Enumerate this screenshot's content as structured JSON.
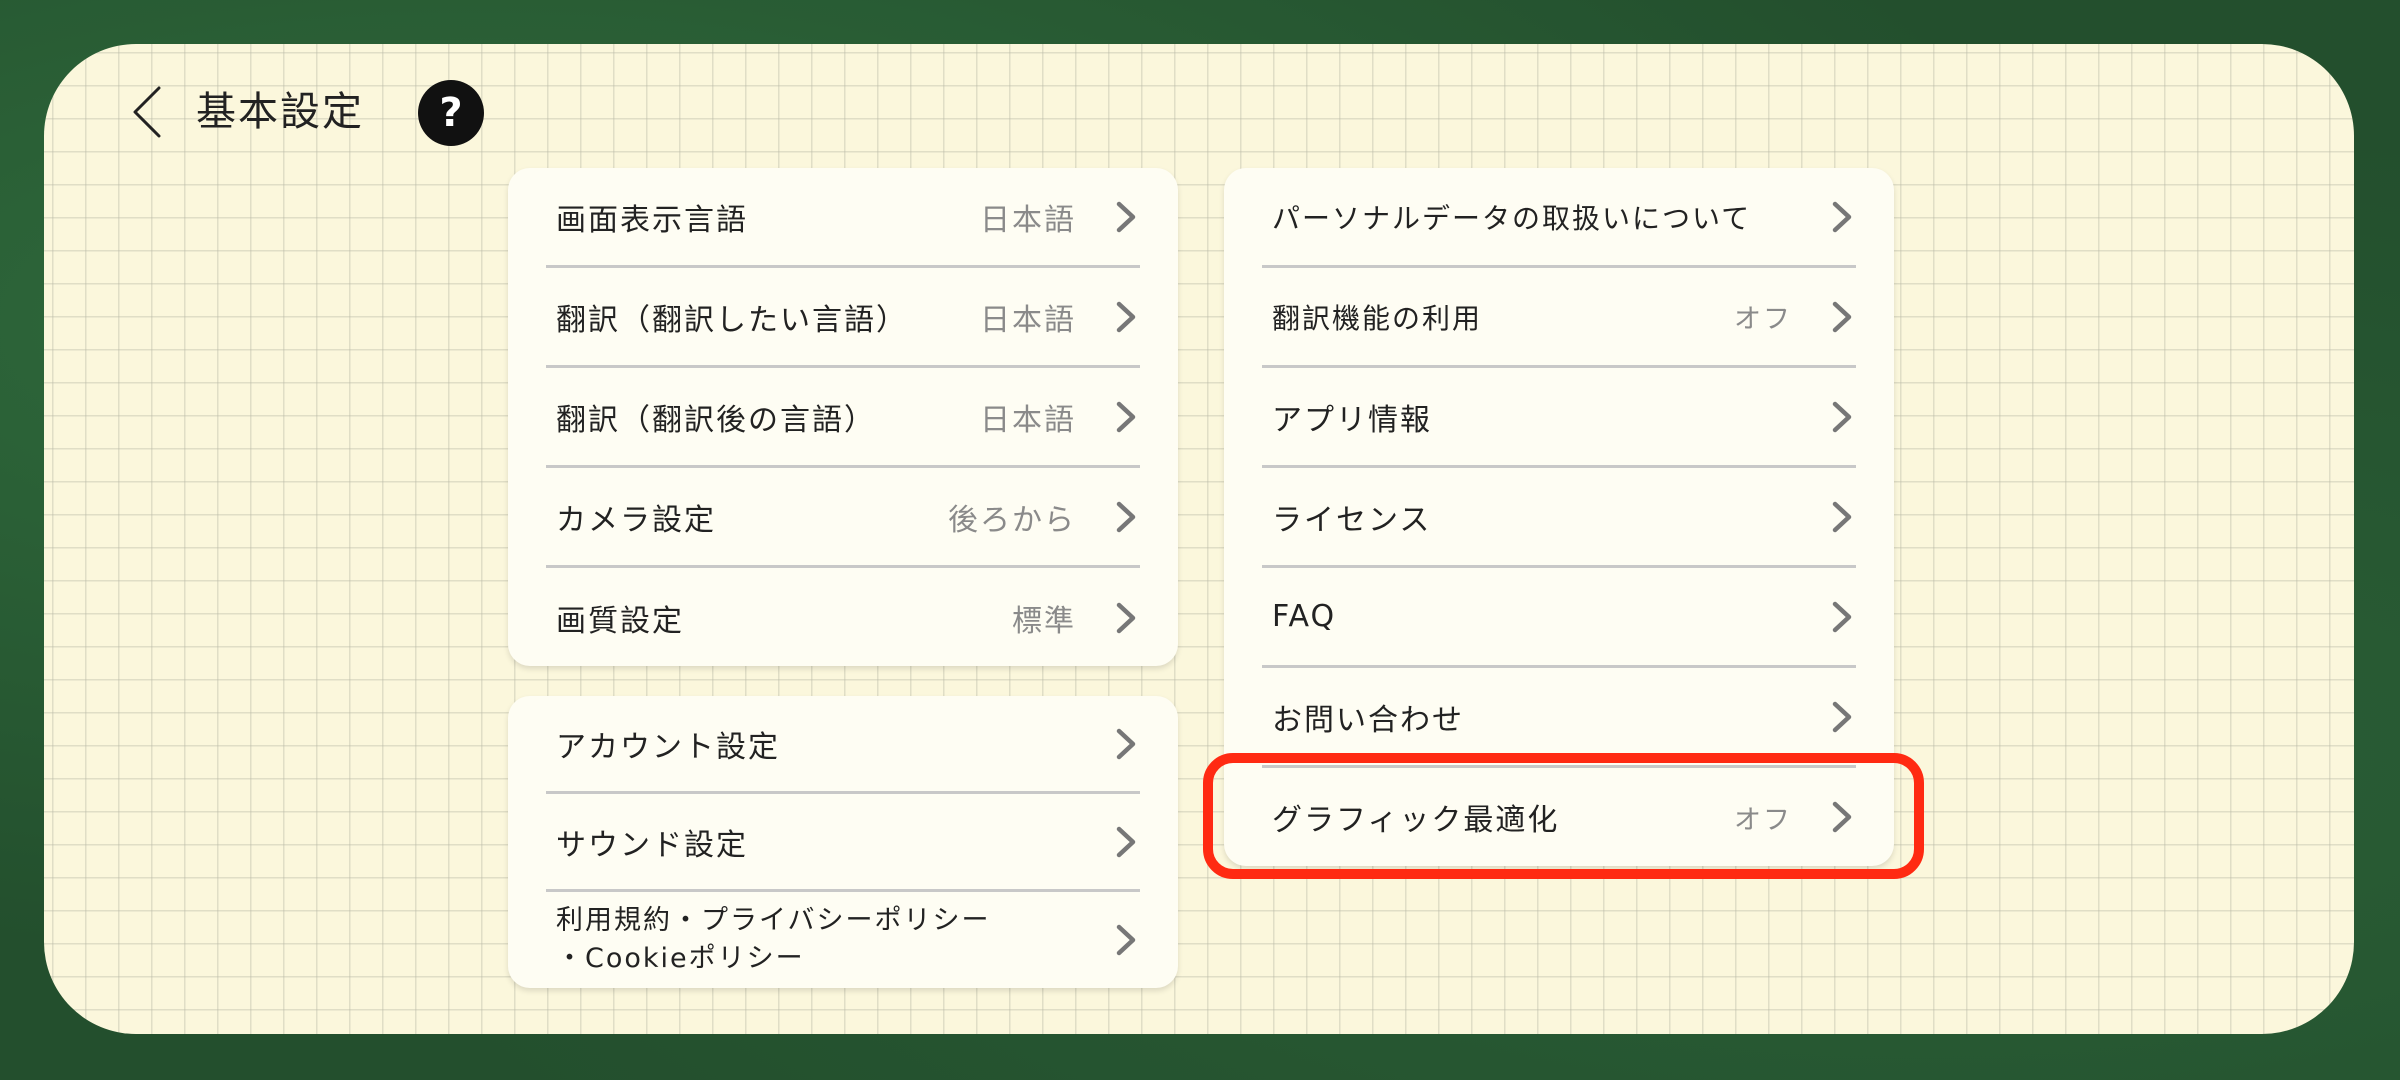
{
  "header": {
    "title": "基本設定",
    "help_label": "?"
  },
  "left_top_card": {
    "items": [
      {
        "label": "画面表示言語",
        "value": "日本語"
      },
      {
        "label": "翻訳（翻訳したい言語）",
        "value": "日本語"
      },
      {
        "label": "翻訳（翻訳後の言語）",
        "value": "日本語"
      },
      {
        "label": "カメラ設定",
        "value": "後ろから"
      },
      {
        "label": "画質設定",
        "value": "標準"
      }
    ]
  },
  "left_bottom_card": {
    "items": [
      {
        "label": "アカウント設定"
      },
      {
        "label": "サウンド設定"
      },
      {
        "label_line1": "利用規約・プライバシーポリシー",
        "label_line2": "・Cookieポリシー"
      }
    ]
  },
  "right_card": {
    "items": [
      {
        "label": "パーソナルデータの取扱いについて"
      },
      {
        "label": "翻訳機能の利用",
        "value": "オフ"
      },
      {
        "label": "アプリ情報"
      },
      {
        "label": "ライセンス"
      },
      {
        "label": "FAQ"
      },
      {
        "label": "お問い合わせ"
      },
      {
        "label": "グラフィック最適化",
        "value": "オフ"
      }
    ]
  },
  "colors": {
    "background": "#234f2d",
    "panel": "#fbf7dc",
    "card": "#fefdf3",
    "highlight": "#ff2a12",
    "value_text": "#8a8a8a",
    "chevron": "#777777"
  },
  "icons": {
    "back": "chevron-left-icon",
    "help": "question-circle-icon",
    "row_arrow": "chevron-right-icon"
  }
}
